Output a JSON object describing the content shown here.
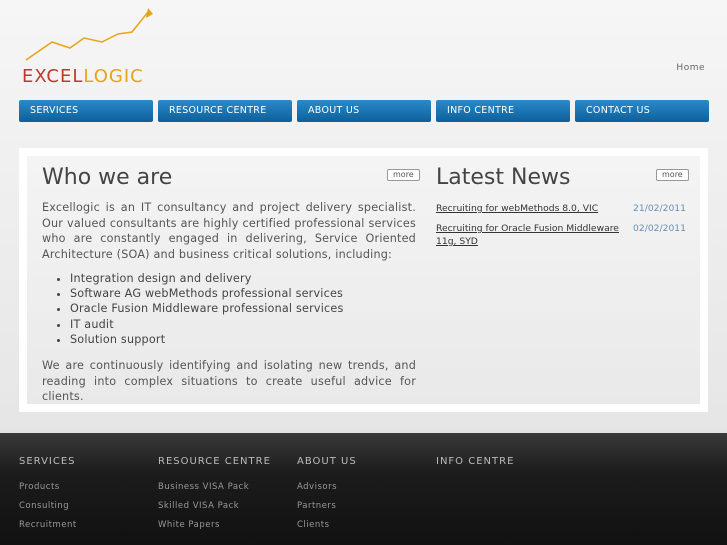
{
  "brand": {
    "logo_part1": "EXCEL",
    "logo_part2": "LOGIC",
    "accent": "#e8a317",
    "accent2": "#c0392b"
  },
  "top_link": "Home",
  "nav": [
    "SERVICES",
    "RESOURCE CENTRE",
    "ABOUT US",
    "INFO CENTRE",
    "CONTACT US"
  ],
  "who": {
    "title": "Who we are",
    "more": "more",
    "intro": "Excellogic is an IT consultancy and project delivery specialist. Our valued consultants are highly certified professional services who are constantly engaged in delivering, Service Oriented Architecture (SOA) and business critical solutions, including:",
    "items": [
      "Integration design and delivery",
      "Software AG webMethods professional services",
      "Oracle Fusion Middleware professional services",
      "IT audit",
      "Solution support"
    ],
    "outro": "We are continuously identifying and isolating new trends, and reading into complex situations to create useful advice for clients."
  },
  "news": {
    "title": "Latest News",
    "more": "more",
    "items": [
      {
        "text": "Recruiting for webMethods 8.0, VIC",
        "date": "21/02/2011"
      },
      {
        "text": "Recruiting for Oracle Fusion Middleware 11g, SYD",
        "date": "02/02/2011"
      }
    ]
  },
  "footer": [
    {
      "heading": "SERVICES",
      "links": [
        "Products",
        "Consulting",
        "Recruitment"
      ]
    },
    {
      "heading": "RESOURCE CENTRE",
      "links": [
        "Business VISA Pack",
        "Skilled VISA Pack",
        "White Papers"
      ]
    },
    {
      "heading": "ABOUT US",
      "links": [
        "Advisors",
        "Partners",
        "Clients"
      ]
    },
    {
      "heading": "INFO CENTRE",
      "links": []
    }
  ]
}
